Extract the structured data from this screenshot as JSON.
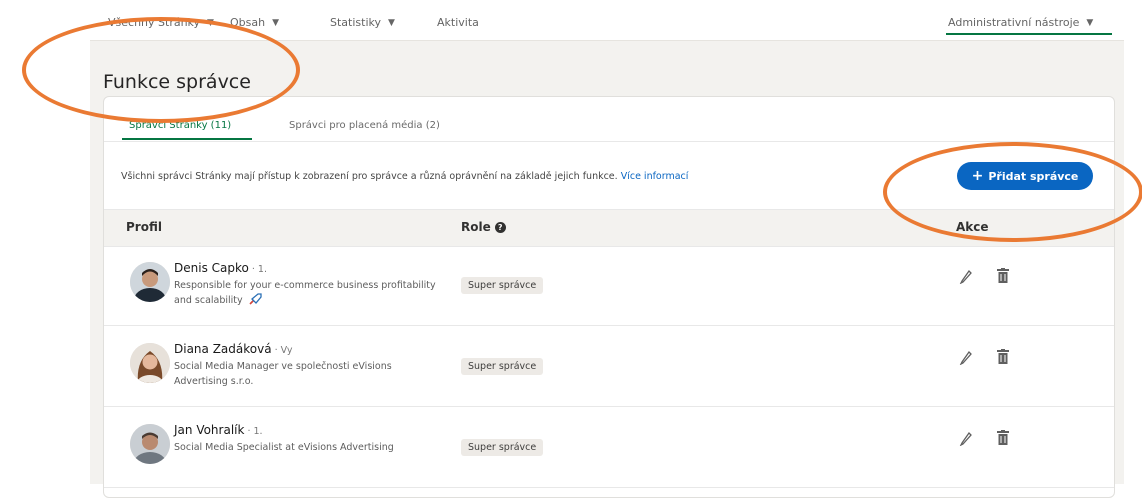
{
  "nav": {
    "items": [
      {
        "label": "Všechny Stránky",
        "caret": "▼"
      },
      {
        "label": "Obsah",
        "caret": "▼"
      },
      {
        "label": "Statistiky",
        "caret": "▼"
      },
      {
        "label": "Aktivita"
      }
    ],
    "admin_tools": {
      "label": "Administrativní nástroje",
      "caret": "▼"
    }
  },
  "page_title": "Funkce správce",
  "tabs": [
    {
      "label": "Správci Stránky (11)",
      "active": true
    },
    {
      "label": "Správci pro placená média (2)",
      "active": false
    }
  ],
  "info": {
    "text": "Všichni správci Stránky mají přístup k zobrazení pro správce a různá oprávnění na základě jejich funkce. ",
    "link": "Více informací"
  },
  "add_button": {
    "plus": "+",
    "label": "Přidat správce"
  },
  "table": {
    "headers": {
      "profile": "Profil",
      "role": "Role",
      "actions": "Akce"
    },
    "rows": [
      {
        "name": "Denis Capko",
        "degree": " · 1.",
        "headline": "Responsible for your e-commerce business profitability and scalability",
        "role": "Super správce"
      },
      {
        "name": "Diana Zadáková",
        "degree": " · Vy",
        "headline": "Social Media Manager ve společnosti eVisions Advertising s.r.o.",
        "role": "Super správce"
      },
      {
        "name": "Jan Vohralík",
        "degree": " · 1.",
        "headline": "Social Media Specialist at eVisions Advertising",
        "role": "Super správce"
      }
    ]
  },
  "colors": {
    "accent_green": "#057642",
    "primary_blue": "#0a66c2",
    "annotation_orange": "#ea7a33",
    "page_bg": "#f3f2ef"
  },
  "icons": [
    "caret-down-icon",
    "help-circle-icon",
    "rocket-icon",
    "pencil-icon",
    "trash-icon"
  ]
}
